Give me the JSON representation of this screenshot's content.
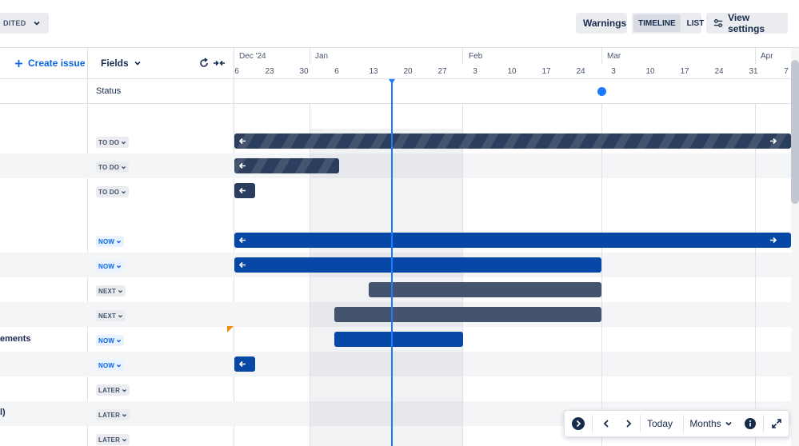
{
  "toolbar": {
    "status_filter": "DITED",
    "warnings": "Warnings",
    "view_timeline": "TIMELINE",
    "view_list": "LIST",
    "view_settings": "View settings"
  },
  "header": {
    "create_issue": "Create issue",
    "fields": "Fields",
    "status_label": "Status"
  },
  "timeline": {
    "months": [
      "Dec '24",
      "Jan",
      "Feb",
      "Mar",
      "Apr"
    ],
    "days": [
      "6",
      "23",
      "30",
      "6",
      "13",
      "20",
      "27",
      "3",
      "10",
      "17",
      "24",
      "3",
      "10",
      "17",
      "24",
      "31",
      "7"
    ]
  },
  "rows": [
    {
      "title": "",
      "status": "TO DO"
    },
    {
      "title": "",
      "status": "TO DO"
    },
    {
      "title": "",
      "status": "TO DO"
    },
    {
      "title": "",
      "status": "NOW"
    },
    {
      "title": "",
      "status": "NOW"
    },
    {
      "title": "",
      "status": "NEXT"
    },
    {
      "title": "",
      "status": "NEXT"
    },
    {
      "title": "ements",
      "status": "NOW"
    },
    {
      "title": "",
      "status": "NOW"
    },
    {
      "title": "",
      "status": "LATER"
    },
    {
      "title": "l)",
      "status": "LATER"
    },
    {
      "title": "",
      "status": "LATER"
    }
  ],
  "controls": {
    "today": "Today",
    "zoom": "Months"
  },
  "colors": {
    "accent": "#0c66e4",
    "today_line": "#1d7afc",
    "bar_blue": "#0747a6",
    "bar_slate": "#44546f",
    "bar_dark": "#2c3e5d"
  },
  "icons": {
    "status_dropdown": "chevron-down-icon",
    "create": "plus-icon",
    "fields_dropdown": "chevron-down-icon",
    "reset": "refresh-icon",
    "collapse": "collapse-arrows-icon",
    "view_settings": "sliders-icon",
    "bar_left": "arrow-left-icon",
    "bar_right": "arrow-right-icon",
    "expand_panel": "chevron-right-circle-icon",
    "prev": "chevron-left-icon",
    "next": "chevron-right-icon",
    "info": "info-icon",
    "fullscreen": "expand-icon"
  }
}
